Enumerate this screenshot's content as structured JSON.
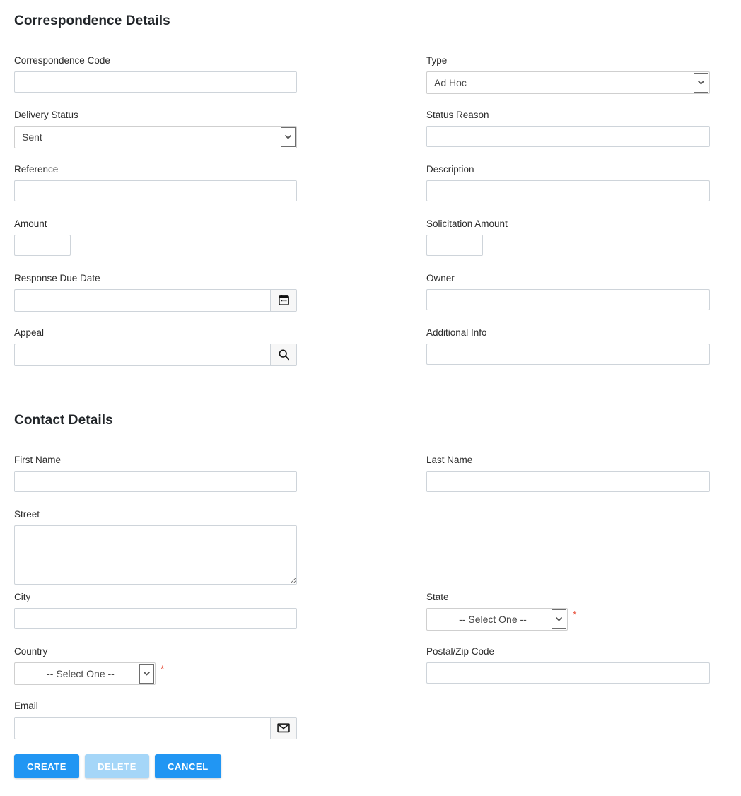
{
  "sections": {
    "correspondence": {
      "title": "Correspondence Details",
      "fields": {
        "correspondence_code": {
          "label": "Correspondence Code",
          "value": ""
        },
        "type": {
          "label": "Type",
          "value": "Ad Hoc"
        },
        "delivery_status": {
          "label": "Delivery Status",
          "value": "Sent"
        },
        "status_reason": {
          "label": "Status Reason",
          "value": ""
        },
        "reference": {
          "label": "Reference",
          "value": ""
        },
        "description": {
          "label": "Description",
          "value": ""
        },
        "amount": {
          "label": "Amount",
          "value": ""
        },
        "solicitation_amount": {
          "label": "Solicitation Amount",
          "value": ""
        },
        "response_due_date": {
          "label": "Response Due Date",
          "value": "",
          "icon": "calendar-icon"
        },
        "owner": {
          "label": "Owner",
          "value": ""
        },
        "appeal": {
          "label": "Appeal",
          "value": "",
          "icon": "search-icon"
        },
        "additional_info": {
          "label": "Additional Info",
          "value": ""
        }
      }
    },
    "contact": {
      "title": "Contact Details",
      "fields": {
        "first_name": {
          "label": "First Name",
          "value": ""
        },
        "last_name": {
          "label": "Last Name",
          "value": ""
        },
        "street": {
          "label": "Street",
          "value": ""
        },
        "city": {
          "label": "City",
          "value": ""
        },
        "state": {
          "label": "State",
          "value": "-- Select One --",
          "required_marker": "*"
        },
        "country": {
          "label": "Country",
          "value": "-- Select One --",
          "required_marker": "*"
        },
        "postal_zip_code": {
          "label": "Postal/Zip Code",
          "value": ""
        },
        "email": {
          "label": "Email",
          "value": "",
          "icon": "envelope-icon"
        }
      }
    }
  },
  "actions": {
    "create_label": "CREATE",
    "delete_label": "DELETE",
    "cancel_label": "CANCEL"
  },
  "colors": {
    "primary_button": "#2196f3",
    "disabled_button": "#a5d6f8",
    "required_asterisk": "#e8543f",
    "border": "#ced4da",
    "heading_text": "#212529"
  }
}
